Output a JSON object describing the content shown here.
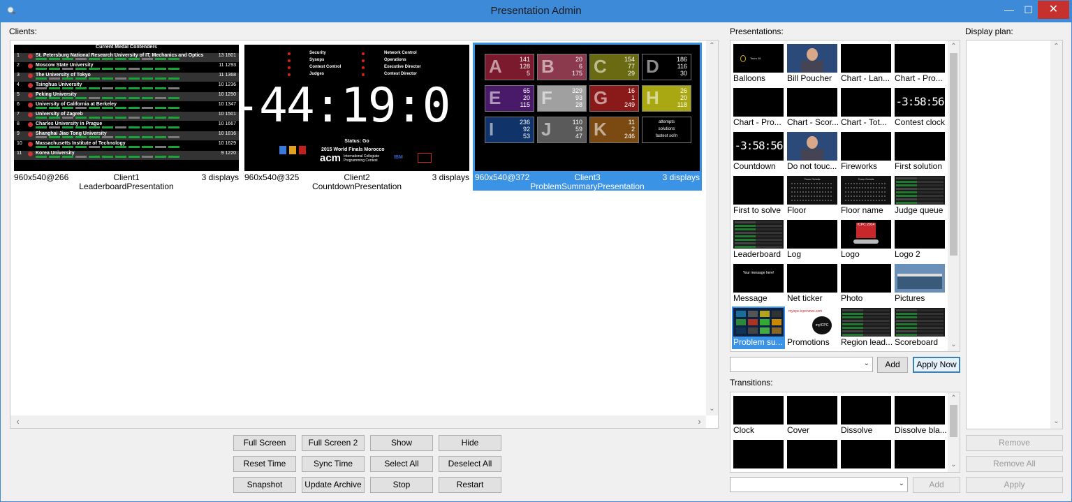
{
  "window": {
    "title": "Presentation Admin",
    "min_glyph": "—",
    "max_glyph": "☐",
    "close_glyph": "✕"
  },
  "clients_label": "Clients:",
  "clients": [
    {
      "resolution": "960x540@266",
      "name": "Client1",
      "displays": "3 displays",
      "presentation": "LeaderboardPresentation",
      "selected": false
    },
    {
      "resolution": "960x540@325",
      "name": "Client2",
      "displays": "3 displays",
      "presentation": "CountdownPresentation",
      "selected": false
    },
    {
      "resolution": "960x540@372",
      "name": "Client3",
      "displays": "3 displays",
      "presentation": "ProblemSummaryPresentation",
      "selected": true
    }
  ],
  "leaderboard_thumb": {
    "title": "Current Medal Contenders",
    "rows": [
      {
        "rank": "1",
        "team": "St. Petersburg National Research University of IT, Mechanics and Optics",
        "score": "13 1801"
      },
      {
        "rank": "2",
        "team": "Moscow State University",
        "score": "11 1293"
      },
      {
        "rank": "3",
        "team": "The University of Tokyo",
        "score": "11 1368"
      },
      {
        "rank": "4",
        "team": "Tsinghua University",
        "score": "10 1236"
      },
      {
        "rank": "5",
        "team": "Peking University",
        "score": "10 1250"
      },
      {
        "rank": "6",
        "team": "University of California at Berkeley",
        "score": "10 1347"
      },
      {
        "rank": "7",
        "team": "University of Zagreb",
        "score": "10 1501"
      },
      {
        "rank": "8",
        "team": "Charles University in Prague",
        "score": "10 1667"
      },
      {
        "rank": "9",
        "team": "Shanghai Jiao Tong University",
        "score": "10 1816"
      },
      {
        "rank": "10",
        "team": "Massachusetts Institute of Technology",
        "score": "10 1629"
      },
      {
        "rank": "11",
        "team": "Korea University",
        "score": "9 1220"
      }
    ]
  },
  "countdown_thumb": {
    "clock": "-44:19:0",
    "roles_left": [
      "Security",
      "Sysops",
      "Contest Control",
      "Judges"
    ],
    "roles_right": [
      "Network Control",
      "Operations",
      "Executive Director",
      "Contest Director"
    ],
    "status": "Status: Go",
    "event": "2015 World Finals Morocco",
    "acm": "acm",
    "acm_sub": "International Collegiate Programming Contest",
    "sponsor": "IBM"
  },
  "problem_summary_thumb": {
    "problems": [
      {
        "letter": "A",
        "nums": [
          "141",
          "128",
          "5"
        ],
        "color": "#7a1a2c"
      },
      {
        "letter": "B",
        "nums": [
          "20",
          "6",
          "175"
        ],
        "color": "#8a3a4c"
      },
      {
        "letter": "C",
        "nums": [
          "154",
          "77",
          "29"
        ],
        "color": "#6a6a12"
      },
      {
        "letter": "D",
        "nums": [
          "186",
          "116",
          "30"
        ],
        "color": "#000000"
      },
      {
        "letter": "E",
        "nums": [
          "65",
          "20",
          "115"
        ],
        "color": "#4a1a6a"
      },
      {
        "letter": "F",
        "nums": [
          "329",
          "93",
          "28"
        ],
        "color": "#a0a0a0"
      },
      {
        "letter": "G",
        "nums": [
          "16",
          "1",
          "249"
        ],
        "color": "#8a1a1a"
      },
      {
        "letter": "H",
        "nums": [
          "26",
          "20",
          "118"
        ],
        "color": "#aaa812"
      },
      {
        "letter": "I",
        "nums": [
          "236",
          "92",
          "53"
        ],
        "color": "#10336a"
      },
      {
        "letter": "J",
        "nums": [
          "110",
          "59",
          "47"
        ],
        "color": "#5a5a5a"
      },
      {
        "letter": "K",
        "nums": [
          "11",
          "2",
          "246"
        ],
        "color": "#7a4a12"
      }
    ],
    "legend": [
      "attempts",
      "solutions",
      "fastest sol'n"
    ]
  },
  "presentations_label": "Presentations:",
  "presentations": [
    {
      "name": "Balloons",
      "thumb": "balloon"
    },
    {
      "name": "Bill Poucher",
      "thumb": "photo-person"
    },
    {
      "name": "Chart - Lan...",
      "thumb": "black"
    },
    {
      "name": "Chart - Pro...",
      "thumb": "black"
    },
    {
      "name": "Chart - Pro...",
      "thumb": "black"
    },
    {
      "name": "Chart - Scor...",
      "thumb": "black"
    },
    {
      "name": "Chart - Tot...",
      "thumb": "black"
    },
    {
      "name": "Contest clock",
      "thumb": "clock"
    },
    {
      "name": "Countdown",
      "thumb": "clock"
    },
    {
      "name": "Do not touc...",
      "thumb": "photo-person"
    },
    {
      "name": "Fireworks",
      "thumb": "black"
    },
    {
      "name": "First solution",
      "thumb": "black"
    },
    {
      "name": "First to solve",
      "thumb": "black"
    },
    {
      "name": "Floor",
      "thumb": "grid"
    },
    {
      "name": "Floor name",
      "thumb": "grid"
    },
    {
      "name": "Judge queue",
      "thumb": "rows"
    },
    {
      "name": "Leaderboard",
      "thumb": "rows"
    },
    {
      "name": "Log",
      "thumb": "black"
    },
    {
      "name": "Logo",
      "thumb": "logo"
    },
    {
      "name": "Logo 2",
      "thumb": "black"
    },
    {
      "name": "Message",
      "thumb": "message"
    },
    {
      "name": "Net ticker",
      "thumb": "black"
    },
    {
      "name": "Photo",
      "thumb": "black"
    },
    {
      "name": "Pictures",
      "thumb": "building"
    },
    {
      "name": "Problem su...",
      "thumb": "problem",
      "selected": true
    },
    {
      "name": "Promotions",
      "thumb": "promo"
    },
    {
      "name": "Region lead...",
      "thumb": "rows"
    },
    {
      "name": "Scoreboard",
      "thumb": "rows"
    }
  ],
  "thumb_texts": {
    "balloon_caption": "Team 38",
    "clock": "-3:58:56",
    "dnt_caption": "Do not touch ANYTHING!!!",
    "message": "Your message here!",
    "logo": "ICPC 2014",
    "promo_url": "myicpc.icpcnews.com",
    "promo_logo": "myICPC",
    "floor": "Team Details"
  },
  "presentation_combo_value": "",
  "add_label": "Add",
  "apply_now_label": "Apply Now",
  "transitions_label": "Transitions:",
  "transitions": [
    "Clock",
    "Cover",
    "Dissolve",
    "Dissolve bla...",
    "",
    "",
    "",
    ""
  ],
  "transition_combo_value": "",
  "transition_add_label": "Add",
  "display_plan_label": "Display plan:",
  "plan_buttons": {
    "remove": "Remove",
    "remove_all": "Remove All",
    "apply": "Apply"
  },
  "client_buttons": [
    [
      "Full Screen",
      "Full Screen 2",
      "Show",
      "Hide"
    ],
    [
      "Reset Time",
      "Sync Time",
      "Select All",
      "Deselect All"
    ],
    [
      "Snapshot",
      "Update Archive",
      "Stop",
      "Restart"
    ]
  ],
  "scroll_glyphs": {
    "up": "⌃",
    "down": "⌄",
    "left": "‹",
    "right": "›",
    "combo": "⌄"
  }
}
